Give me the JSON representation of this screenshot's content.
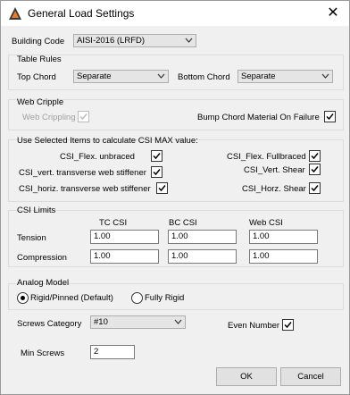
{
  "window": {
    "title": "General Load Settings",
    "close_glyph": "✕"
  },
  "building_code": {
    "label": "Building Code",
    "value": "AISI-2016 (LRFD)"
  },
  "table_rules": {
    "title": "Table Rules",
    "top_chord_label": "Top Chord",
    "top_chord_value": "Separate",
    "bottom_chord_label": "Bottom Chord",
    "bottom_chord_value": "Separate"
  },
  "web_cripple": {
    "title": "Web Cripple",
    "web_crippling_label": "Web Crippling",
    "web_crippling_checked": true,
    "bump_label": "Bump Chord Material On Failure",
    "bump_checked": true
  },
  "csi_items": {
    "title": "Use Selected Items to calculate CSI MAX value:",
    "flex_unbraced": "CSI_Flex. unbraced",
    "flex_fullbraced": "CSI_Flex. Fullbraced",
    "vert_transverse": "CSI_vert. transverse web stiffener",
    "vert_shear": "CSI_Vert. Shear",
    "horiz_transverse": "CSI_horiz. transverse web stiffener",
    "horz_shear": "CSI_Horz. Shear"
  },
  "csi_limits": {
    "title": "CSI Limits",
    "col_tc": "TC CSI",
    "col_bc": "BC CSI",
    "col_web": "Web CSI",
    "tension_label": "Tension",
    "compression_label": "Compression",
    "tension": [
      "1.00",
      "1.00",
      "1.00"
    ],
    "compression": [
      "1.00",
      "1.00",
      "1.00"
    ]
  },
  "analog_model": {
    "title": "Analog Model",
    "option_pinned": "Rigid/Pinned (Default)",
    "option_rigid": "Fully Rigid",
    "selected": "Rigid/Pinned (Default)"
  },
  "screws": {
    "category_label": "Screws Category",
    "category_value": "#10",
    "even_number_label": "Even Number",
    "even_number_checked": true,
    "min_screws_label": "Min Screws",
    "min_screws_value": "2"
  },
  "buttons": {
    "ok": "OK",
    "cancel": "Cancel"
  },
  "colors": {
    "accent_orange": "#f07c22",
    "icon_dark": "#3a3a3a"
  }
}
